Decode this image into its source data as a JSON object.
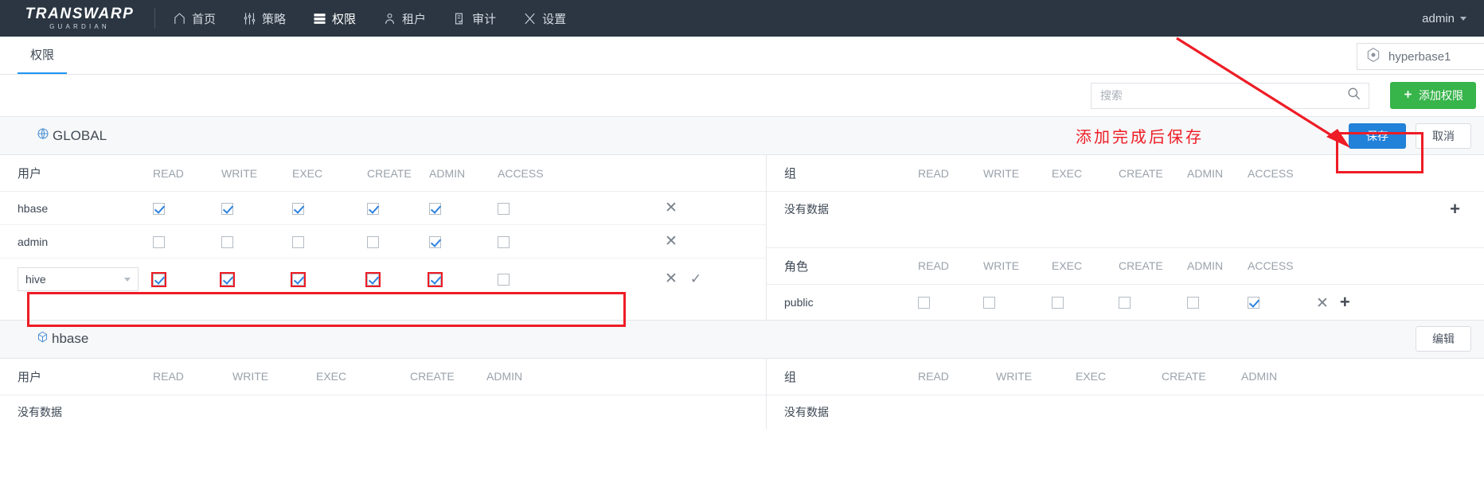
{
  "topnav": {
    "brand_main": "TRANSWARP",
    "brand_sub": "GUARDIAN",
    "items": [
      {
        "label": "首页",
        "icon": "home-icon",
        "active": false
      },
      {
        "label": "策略",
        "icon": "sliders-icon",
        "active": false
      },
      {
        "label": "权限",
        "icon": "server-stack-icon",
        "active": true
      },
      {
        "label": "租户",
        "icon": "users-icon",
        "active": false
      },
      {
        "label": "审计",
        "icon": "clipboard-check-icon",
        "active": false
      },
      {
        "label": "设置",
        "icon": "tools-icon",
        "active": false
      }
    ],
    "user": "admin"
  },
  "tabbar": {
    "tabs": [
      {
        "label": "权限",
        "active": true
      }
    ],
    "cluster": {
      "label": "hyperbase1",
      "icon": "cluster-icon"
    }
  },
  "actionbar": {
    "search": {
      "value": "",
      "placeholder": "搜索"
    },
    "search_icon": "magnifier-icon",
    "add_button": {
      "label": "添加权限",
      "icon": "plus-icon",
      "color": "#37b44a"
    }
  },
  "annotation": {
    "text": "添加完成后保存",
    "color": "#ee1c25"
  },
  "sections": [
    {
      "id": "global",
      "title": "GLOBAL",
      "icon": "globe-icon",
      "editing": true,
      "buttons": {
        "save": "保存",
        "cancel": "取消"
      },
      "left": {
        "name_header": "用户",
        "columns": [
          "READ",
          "WRITE",
          "EXEC",
          "CREATE",
          "ADMIN",
          "ACCESS"
        ],
        "rows": [
          {
            "name": "hbase",
            "type": "text",
            "perms": [
              true,
              true,
              true,
              true,
              true,
              false
            ],
            "actions": [
              "close-icon"
            ],
            "highlight": false
          },
          {
            "name": "admin",
            "type": "text",
            "perms": [
              false,
              false,
              false,
              false,
              true,
              false
            ],
            "actions": [
              "close-icon"
            ],
            "highlight": false
          },
          {
            "name": "hive",
            "type": "select",
            "perms": [
              true,
              true,
              true,
              true,
              true,
              false
            ],
            "actions": [
              "close-icon",
              "check-icon"
            ],
            "highlight": true
          }
        ]
      },
      "right_top": {
        "name_header": "组",
        "columns": [
          "READ",
          "WRITE",
          "EXEC",
          "CREATE",
          "ADMIN",
          "ACCESS"
        ],
        "empty_text": "没有数据",
        "add_icon": "plus-icon",
        "rows": []
      },
      "right_bottom": {
        "name_header": "角色",
        "columns": [
          "READ",
          "WRITE",
          "EXEC",
          "CREATE",
          "ADMIN",
          "ACCESS"
        ],
        "rows": [
          {
            "name": "public",
            "perms": [
              false,
              false,
              false,
              false,
              false,
              true
            ],
            "actions": [
              "close-icon",
              "plus-icon"
            ]
          }
        ]
      }
    },
    {
      "id": "hbase",
      "title": "hbase",
      "icon": "cube-icon",
      "editing": false,
      "buttons": {
        "edit": "编辑"
      },
      "left": {
        "name_header": "用户",
        "columns": [
          "READ",
          "WRITE",
          "EXEC",
          "CREATE",
          "ADMIN"
        ],
        "empty_text": "没有数据",
        "rows": []
      },
      "right_top": {
        "name_header": "组",
        "columns": [
          "READ",
          "WRITE",
          "EXEC",
          "CREATE",
          "ADMIN"
        ],
        "empty_text": "没有数据",
        "rows": []
      }
    }
  ]
}
